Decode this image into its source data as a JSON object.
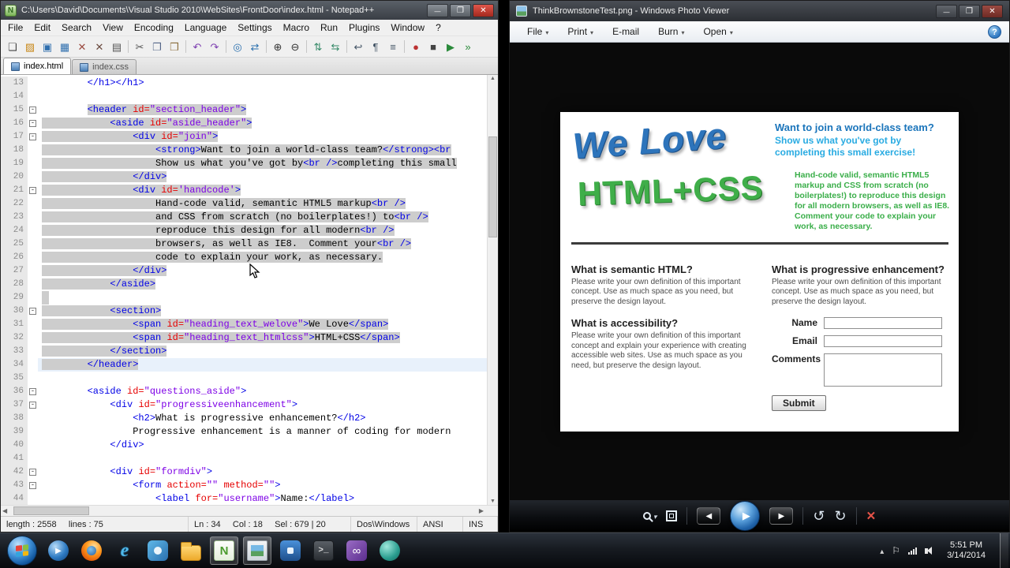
{
  "notepad": {
    "title": "C:\\Users\\David\\Documents\\Visual Studio 2010\\WebSites\\FrontDoor\\index.html - Notepad++",
    "menus": [
      "File",
      "Edit",
      "Search",
      "View",
      "Encoding",
      "Language",
      "Settings",
      "Macro",
      "Run",
      "Plugins",
      "Window",
      "?"
    ],
    "toolbar": [
      {
        "n": "new-file",
        "g": "❏",
        "c": "#444444"
      },
      {
        "n": "open-folder",
        "g": "▨",
        "c": "#c8881a"
      },
      {
        "n": "save",
        "g": "▣",
        "c": "#2f6fae"
      },
      {
        "n": "save-all",
        "g": "▦",
        "c": "#2f6fae"
      },
      {
        "n": "close",
        "g": "✕",
        "c": "#9a4a3f"
      },
      {
        "n": "close-all",
        "g": "✕",
        "c": "#6a4a3f"
      },
      {
        "n": "print",
        "g": "▤",
        "c": "#555555"
      },
      {
        "sep": true
      },
      {
        "n": "cut",
        "g": "✂",
        "c": "#555555"
      },
      {
        "n": "copy",
        "g": "❐",
        "c": "#556688"
      },
      {
        "n": "paste",
        "g": "❒",
        "c": "#8a6d3b"
      },
      {
        "sep": true
      },
      {
        "n": "undo",
        "g": "↶",
        "c": "#7d3fb0"
      },
      {
        "n": "redo",
        "g": "↷",
        "c": "#7d3fb0"
      },
      {
        "sep": true
      },
      {
        "n": "find",
        "g": "◎",
        "c": "#2a6fae"
      },
      {
        "n": "replace",
        "g": "⇄",
        "c": "#2a6fae"
      },
      {
        "sep": true
      },
      {
        "n": "zoom-in",
        "g": "⊕",
        "c": "#333333"
      },
      {
        "n": "zoom-out",
        "g": "⊖",
        "c": "#333333"
      },
      {
        "sep": true
      },
      {
        "n": "sync-vertical",
        "g": "⇅",
        "c": "#338866"
      },
      {
        "n": "sync-horizontal",
        "g": "⇆",
        "c": "#338866"
      },
      {
        "sep": true
      },
      {
        "n": "word-wrap",
        "g": "↩",
        "c": "#445566"
      },
      {
        "n": "show-all-characters",
        "g": "¶",
        "c": "#445566"
      },
      {
        "n": "indent-guide",
        "g": "≡",
        "c": "#445566"
      },
      {
        "sep": true
      },
      {
        "n": "record-macro",
        "g": "●",
        "c": "#bb3333"
      },
      {
        "n": "stop-macro",
        "g": "■",
        "c": "#444444"
      },
      {
        "n": "play-macro",
        "g": "▶",
        "c": "#2a8a3a"
      },
      {
        "n": "run-macro-multiple",
        "g": "»",
        "c": "#2a8a3a"
      }
    ],
    "tabs": [
      {
        "label": "index.html",
        "active": true
      },
      {
        "label": "index.css",
        "active": false
      }
    ],
    "code_lines": [
      {
        "n": 13,
        "i": 8,
        "t": [
          [
            "t",
            "</h1></h1>"
          ]
        ]
      },
      {
        "n": 14
      },
      {
        "n": 15,
        "i": 8,
        "s": "code",
        "f": 1,
        "t": [
          [
            "t",
            "<header "
          ],
          [
            "a",
            "id="
          ],
          [
            "v",
            "\"section_header\""
          ],
          [
            "t",
            ">"
          ]
        ]
      },
      {
        "n": 16,
        "i": 12,
        "s": "full",
        "f": 1,
        "t": [
          [
            "t",
            "<aside "
          ],
          [
            "a",
            "id="
          ],
          [
            "v",
            "\"aside_header\""
          ],
          [
            "t",
            ">"
          ]
        ]
      },
      {
        "n": 17,
        "i": 16,
        "s": "full",
        "f": 1,
        "t": [
          [
            "t",
            "<div "
          ],
          [
            "a",
            "id="
          ],
          [
            "v",
            "\"join\""
          ],
          [
            "t",
            ">"
          ]
        ]
      },
      {
        "n": 18,
        "i": 20,
        "s": "full",
        "t": [
          [
            "t",
            "<strong>"
          ],
          [
            "x",
            "Want to join a world-class team?"
          ],
          [
            "t",
            "</strong>"
          ],
          [
            "t",
            "<br"
          ]
        ]
      },
      {
        "n": 19,
        "i": 20,
        "s": "full",
        "t": [
          [
            "x",
            "Show us what you've got by"
          ],
          [
            "t",
            "<br />"
          ],
          [
            "x",
            "completing this small"
          ]
        ]
      },
      {
        "n": 20,
        "i": 16,
        "s": "full",
        "t": [
          [
            "t",
            "</div>"
          ]
        ]
      },
      {
        "n": 21,
        "i": 16,
        "s": "full",
        "f": 1,
        "t": [
          [
            "t",
            "<div "
          ],
          [
            "a",
            "id="
          ],
          [
            "v",
            "'handcode'"
          ],
          [
            "t",
            ">"
          ]
        ]
      },
      {
        "n": 22,
        "i": 20,
        "s": "full",
        "t": [
          [
            "x",
            "Hand-code valid, semantic HTML5 markup"
          ],
          [
            "t",
            "<br />"
          ]
        ]
      },
      {
        "n": 23,
        "i": 20,
        "s": "full",
        "t": [
          [
            "x",
            "and CSS from scratch (no boilerplates!) to"
          ],
          [
            "t",
            "<br />"
          ]
        ]
      },
      {
        "n": 24,
        "i": 20,
        "s": "full",
        "t": [
          [
            "x",
            "reproduce this design for all modern"
          ],
          [
            "t",
            "<br />"
          ]
        ]
      },
      {
        "n": 25,
        "i": 20,
        "s": "full",
        "t": [
          [
            "x",
            "browsers, as well as IE8.  Comment your"
          ],
          [
            "t",
            "<br />"
          ]
        ]
      },
      {
        "n": 26,
        "i": 20,
        "s": "full",
        "t": [
          [
            "x",
            "code to explain your work, as necessary."
          ]
        ]
      },
      {
        "n": 27,
        "i": 16,
        "s": "full",
        "t": [
          [
            "t",
            "</div>"
          ]
        ]
      },
      {
        "n": 28,
        "i": 12,
        "s": "full",
        "t": [
          [
            "t",
            "</aside>"
          ]
        ]
      },
      {
        "n": 29,
        "s": "chip"
      },
      {
        "n": 30,
        "i": 12,
        "s": "full",
        "f": 1,
        "t": [
          [
            "t",
            "<section>"
          ]
        ]
      },
      {
        "n": 31,
        "i": 16,
        "s": "full",
        "t": [
          [
            "t",
            "<span "
          ],
          [
            "a",
            "id="
          ],
          [
            "v",
            "\"heading_text_welove\""
          ],
          [
            "t",
            ">"
          ],
          [
            "x",
            "We Love"
          ],
          [
            "t",
            "</span>"
          ]
        ]
      },
      {
        "n": 32,
        "i": 16,
        "s": "full",
        "t": [
          [
            "t",
            "<span "
          ],
          [
            "a",
            "id="
          ],
          [
            "v",
            "\"heading_text_htmlcss\""
          ],
          [
            "t",
            ">"
          ],
          [
            "x",
            "HTML+CSS"
          ],
          [
            "t",
            "</span>"
          ]
        ]
      },
      {
        "n": 33,
        "i": 12,
        "s": "full",
        "t": [
          [
            "t",
            "</section>"
          ]
        ]
      },
      {
        "n": 34,
        "i": 8,
        "s": "full",
        "cur": 1,
        "t": [
          [
            "t",
            "</header>"
          ]
        ]
      },
      {
        "n": 35
      },
      {
        "n": 36,
        "i": 8,
        "f": 1,
        "t": [
          [
            "t",
            "<aside "
          ],
          [
            "a",
            "id="
          ],
          [
            "v",
            "\"questions_aside\""
          ],
          [
            "t",
            ">"
          ]
        ]
      },
      {
        "n": 37,
        "i": 12,
        "f": 1,
        "t": [
          [
            "t",
            "<div "
          ],
          [
            "a",
            "id="
          ],
          [
            "v",
            "\"progressiveenhancement\""
          ],
          [
            "t",
            ">"
          ]
        ]
      },
      {
        "n": 38,
        "i": 16,
        "t": [
          [
            "t",
            "<h2>"
          ],
          [
            "x",
            "What is progressive enhancement?"
          ],
          [
            "t",
            "</h2>"
          ]
        ]
      },
      {
        "n": 39,
        "i": 16,
        "t": [
          [
            "x",
            "Progressive enhancement is a manner of coding for modern"
          ]
        ]
      },
      {
        "n": 40,
        "i": 12,
        "t": [
          [
            "t",
            "</div>"
          ]
        ]
      },
      {
        "n": 41
      },
      {
        "n": 42,
        "i": 12,
        "f": 1,
        "t": [
          [
            "t",
            "<div "
          ],
          [
            "a",
            "id="
          ],
          [
            "v",
            "\"formdiv\""
          ],
          [
            "t",
            ">"
          ]
        ]
      },
      {
        "n": 43,
        "i": 16,
        "f": 1,
        "t": [
          [
            "t",
            "<form "
          ],
          [
            "a",
            "action="
          ],
          [
            "v",
            "\"\""
          ],
          [
            "t",
            " "
          ],
          [
            "a",
            "method="
          ],
          [
            "v",
            "\"\""
          ],
          [
            "t",
            ">"
          ]
        ]
      },
      {
        "n": 44,
        "i": 20,
        "t": [
          [
            "t",
            "<label "
          ],
          [
            "a",
            "for="
          ],
          [
            "v",
            "\"username\""
          ],
          [
            "t",
            ">"
          ],
          [
            "x",
            "Name:"
          ],
          [
            "t",
            "</label>"
          ]
        ]
      }
    ],
    "status": [
      "length : 2558     lines : 75",
      "Ln : 34     Col : 18     Sel : 679 | 20",
      "Dos\\Windows",
      "ANSI",
      "INS"
    ]
  },
  "photo_viewer": {
    "title": "ThinkBrownstoneTest.png - Windows Photo Viewer",
    "menu": [
      {
        "label": "File",
        "arrow": true
      },
      {
        "label": "Print",
        "arrow": true
      },
      {
        "label": "E-mail",
        "arrow": false
      },
      {
        "label": "Burn",
        "arrow": true
      },
      {
        "label": "Open",
        "arrow": true
      }
    ],
    "mockup": {
      "title_line1": "We Love",
      "title_line2": "HTML+CSS",
      "join_heading": "Want to join a world-class team?",
      "join_sub": "Show us what you've got by completing this small exercise!",
      "handcode": "Hand-code valid, semantic HTML5 markup and CSS from scratch (no boilerplates!) to reproduce this design for all modern browsers, as well as IE8. Comment your code to explain your work, as necessary.",
      "q1_heading": "What is semantic HTML?",
      "q1_body": "Please write your own definition of this important concept. Use as much space as you need, but preserve the design layout.",
      "q2_heading": "What is accessibility?",
      "q2_body": "Please write your own definition of this important concept and explain your experience with creating accessible web sites. Use as much space as you need, but preserve the design layout.",
      "q3_heading": "What is progressive enhancement?",
      "q3_body": "Please write your own definition of this important concept. Use as much space as you need, but preserve the design layout.",
      "form": {
        "name_label": "Name",
        "email_label": "Email",
        "comments_label": "Comments",
        "submit_label": "Submit"
      }
    }
  },
  "taskbar": {
    "apps": [
      {
        "id": "media-player"
      },
      {
        "id": "firefox"
      },
      {
        "id": "internet-explorer"
      },
      {
        "id": "messenger"
      },
      {
        "id": "explorer"
      },
      {
        "id": "notepad-plus-plus",
        "active": true
      },
      {
        "id": "photo-viewer",
        "active": true
      },
      {
        "id": "app-blue"
      },
      {
        "id": "console"
      },
      {
        "id": "visual-studio"
      },
      {
        "id": "app-teal"
      }
    ],
    "clock_time": "5:51 PM",
    "clock_date": "3/14/2014"
  }
}
